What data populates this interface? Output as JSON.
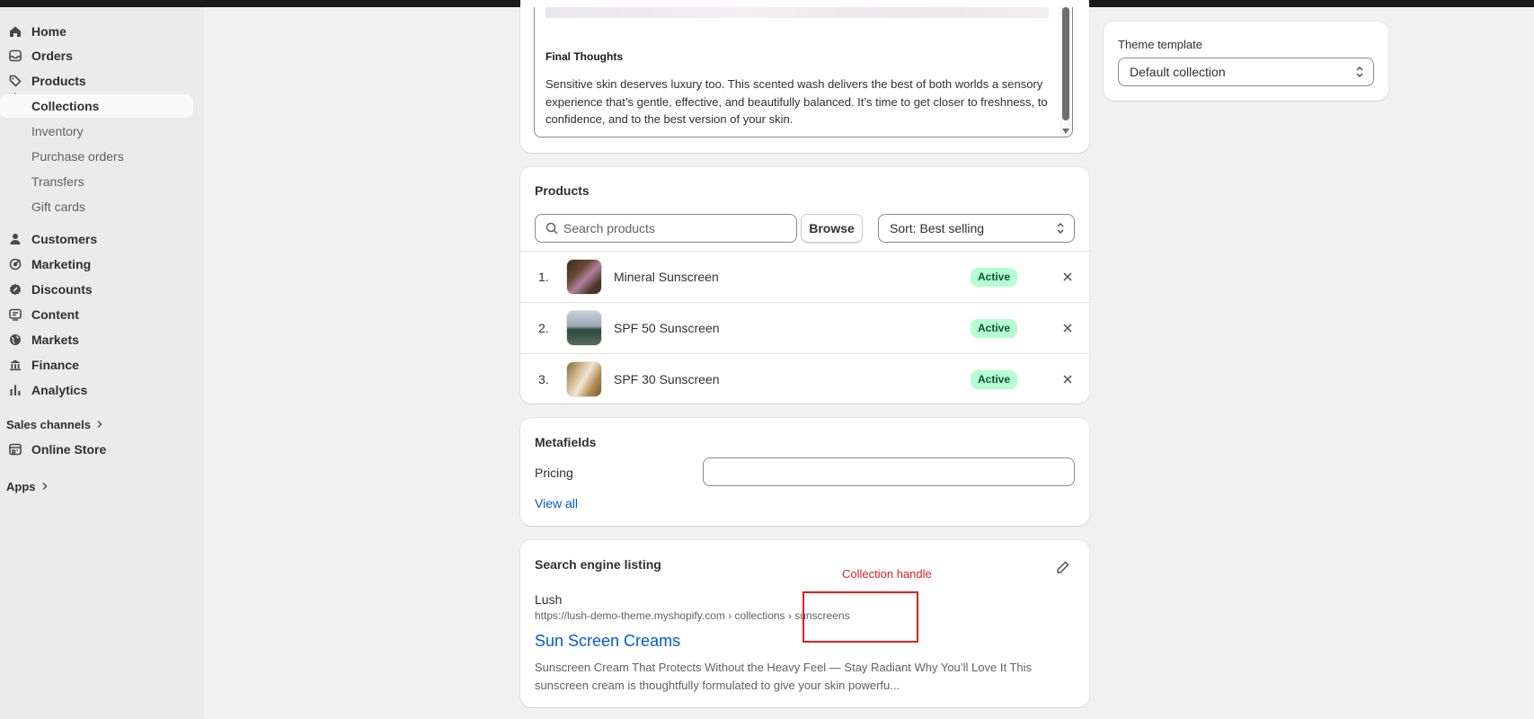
{
  "sidebar": {
    "items": [
      {
        "label": "Home",
        "icon": "home-icon"
      },
      {
        "label": "Orders",
        "icon": "inbox-icon"
      },
      {
        "label": "Products",
        "icon": "tag-icon"
      },
      {
        "label": "Collections"
      },
      {
        "label": "Inventory"
      },
      {
        "label": "Purchase orders"
      },
      {
        "label": "Transfers"
      },
      {
        "label": "Gift cards"
      },
      {
        "label": "Customers",
        "icon": "person-icon"
      },
      {
        "label": "Marketing",
        "icon": "target-icon"
      },
      {
        "label": "Discounts",
        "icon": "discount-icon"
      },
      {
        "label": "Content",
        "icon": "content-icon"
      },
      {
        "label": "Markets",
        "icon": "globe-icon"
      },
      {
        "label": "Finance",
        "icon": "bank-icon"
      },
      {
        "label": "Analytics",
        "icon": "bar-chart-icon"
      }
    ],
    "sales_channels_label": "Sales channels",
    "online_store_label": "Online Store",
    "apps_label": "Apps"
  },
  "description": {
    "heading": "Final Thoughts",
    "paragraph": "Sensitive skin deserves luxury too. This scented wash delivers the best of both worlds a sensory experience that’s gentle, effective, and beautifully balanced. It’s time to get closer to freshness, to confidence, and to the best version of your skin."
  },
  "products": {
    "title": "Products",
    "search_placeholder": "Search products",
    "browse_label": "Browse",
    "sort_label": "Sort: Best selling",
    "items": [
      {
        "num": "1.",
        "name": "Mineral Sunscreen",
        "status": "Active"
      },
      {
        "num": "2.",
        "name": "SPF 50 Sunscreen",
        "status": "Active"
      },
      {
        "num": "3.",
        "name": "SPF 30 Sunscreen",
        "status": "Active"
      }
    ]
  },
  "metafields": {
    "title": "Metafields",
    "pricing_label": "Pricing",
    "pricing_value": "",
    "view_all_label": "View all"
  },
  "seo": {
    "title": "Search engine listing",
    "store_name": "Lush",
    "url": "https://lush-demo-theme.myshopify.com › collections › sunscreens",
    "page_title": "Sun Screen Creams",
    "description": "Sunscreen Cream That Protects Without the Heavy Feel — Stay Radiant Why You’ll Love It This sunscreen cream is thoughtfully formulated to give your skin powerfu..."
  },
  "annotation": {
    "label": "Collection handle",
    "color": "#e02020"
  },
  "theme": {
    "title": "Theme template",
    "selected": "Default collection"
  }
}
